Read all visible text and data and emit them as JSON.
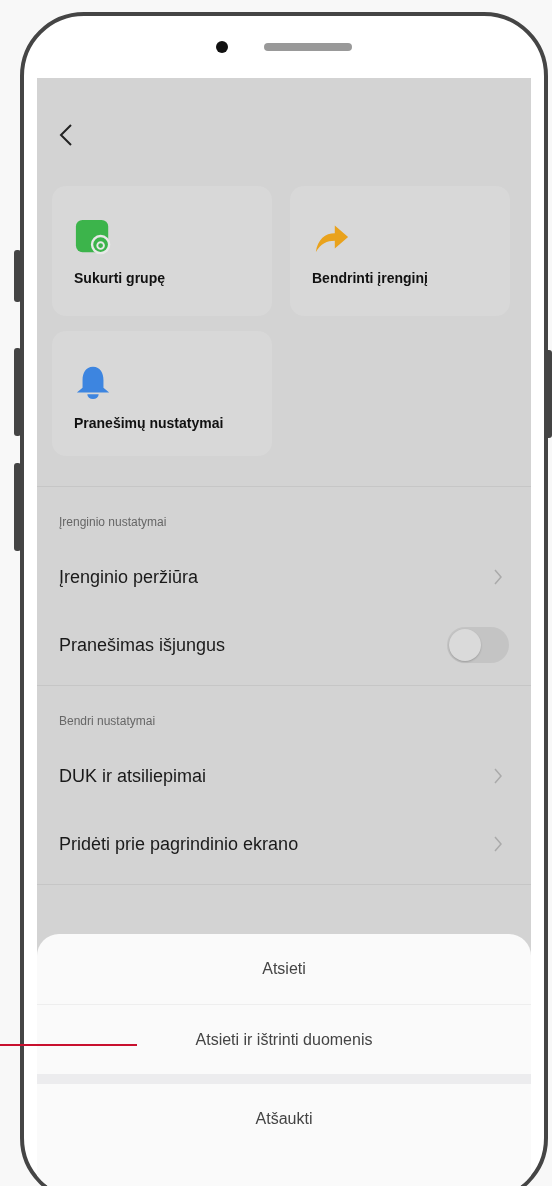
{
  "quick_actions": [
    {
      "label": "Sukurti grupę",
      "kind": "group"
    },
    {
      "label": "Bendrinti įrenginį",
      "kind": "share"
    },
    {
      "label": "Pranešimų nustatymai",
      "kind": "bell"
    }
  ],
  "sections": [
    {
      "title": "Įrenginio nustatymai",
      "items": [
        {
          "label": "Įrenginio peržiūra",
          "kind": "link"
        },
        {
          "label": "Pranešimas išjungus",
          "kind": "toggle",
          "on": false
        }
      ]
    },
    {
      "title": "Bendri nustatymai",
      "items": [
        {
          "label": "DUK ir atsiliepimai",
          "kind": "link"
        },
        {
          "label": "Pridėti prie pagrindinio ekrano",
          "kind": "link"
        }
      ]
    }
  ],
  "action_sheet": {
    "actions": [
      "Atsieti",
      "Atsieti ir ištrinti duomenis"
    ],
    "cancel": "Atšaukti"
  }
}
